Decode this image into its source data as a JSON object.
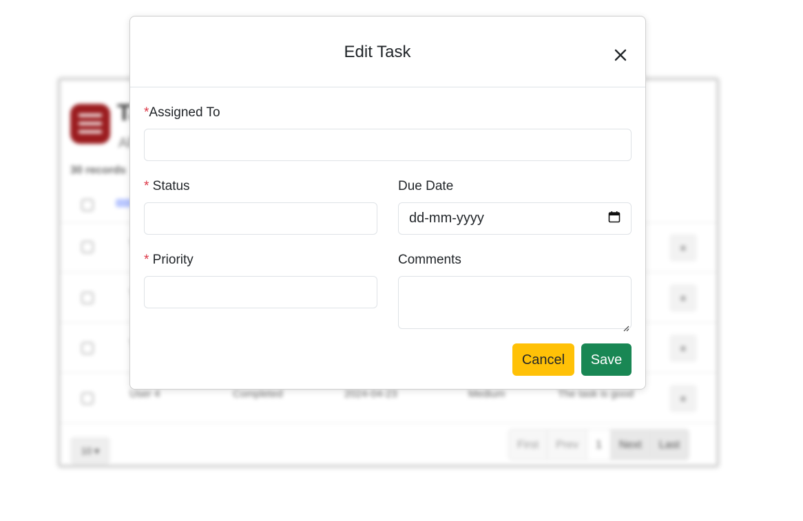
{
  "background": {
    "app_title": "Ta",
    "app_subtitle": "All",
    "records_label": "30 records",
    "header_link": "As",
    "rows": [
      {
        "col1": "T",
        "col2": "",
        "col3": "",
        "col4": "",
        "col5": ""
      },
      {
        "col1": "T",
        "col2": "",
        "col3": "",
        "col4": "",
        "col5": ""
      },
      {
        "col1": "T",
        "col2": "",
        "col3": "",
        "col4": "",
        "col5": ""
      },
      {
        "col1": "User 4",
        "col2": "Completed",
        "col3": "2024-04-23",
        "col4": "Medium",
        "col5": "The task is good"
      }
    ],
    "row_action_label": "≡",
    "page_size": "10 ▾",
    "pager": {
      "first": "First",
      "prev": "Prev",
      "current": "1",
      "next": "Next",
      "last": "Last"
    }
  },
  "modal": {
    "title": "Edit Task",
    "close_icon": "close-icon",
    "fields": {
      "assigned_to": {
        "required_mark": "*",
        "label": "Assigned To",
        "value": ""
      },
      "status": {
        "required_mark": "*",
        "label": " Status",
        "value": ""
      },
      "due_date": {
        "label": "Due Date",
        "placeholder": "dd-mm-yyyy",
        "icon": "calendar-icon"
      },
      "priority": {
        "required_mark": "*",
        "label": " Priority",
        "value": ""
      },
      "comments": {
        "label": "Comments",
        "value": ""
      }
    },
    "buttons": {
      "cancel": "Cancel",
      "save": "Save"
    }
  },
  "colors": {
    "required": "#dc3545",
    "cancel_bg": "#ffc107",
    "save_bg": "#198754",
    "logo_bg": "#9b1c1f"
  }
}
